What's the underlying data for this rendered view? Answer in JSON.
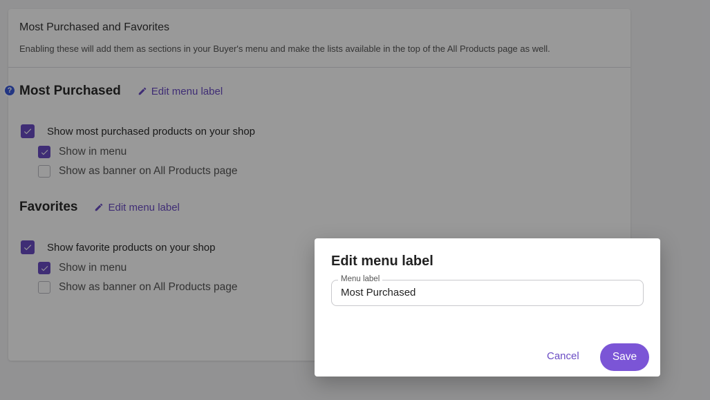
{
  "settings": {
    "title": "Most Purchased and Favorites",
    "description": "Enabling these will add them as sections in your Buyer's menu and make the lists available in the top of the All Products page as well.",
    "help_glyph": "?",
    "sections": [
      {
        "title": "Most Purchased",
        "edit_label": "Edit menu label",
        "main_option": {
          "label": "Show most purchased products on your shop",
          "checked": true
        },
        "show_in_menu": {
          "label": "Show in menu",
          "checked": true
        },
        "show_banner": {
          "label": "Show as banner on All Products page",
          "checked": false
        }
      },
      {
        "title": "Favorites",
        "edit_label": "Edit menu label",
        "main_option": {
          "label": "Show favorite products on your shop",
          "checked": true
        },
        "show_in_menu": {
          "label": "Show in menu",
          "checked": true
        },
        "show_banner": {
          "label": "Show as banner on All Products page",
          "checked": false
        }
      }
    ]
  },
  "dialog": {
    "title": "Edit menu label",
    "field_label": "Menu label",
    "field_value": "Most Purchased",
    "cancel_label": "Cancel",
    "save_label": "Save"
  },
  "colors": {
    "accent": "#6a4cc4",
    "save_button": "#7b55d6",
    "help_icon": "#3b5bdb"
  }
}
